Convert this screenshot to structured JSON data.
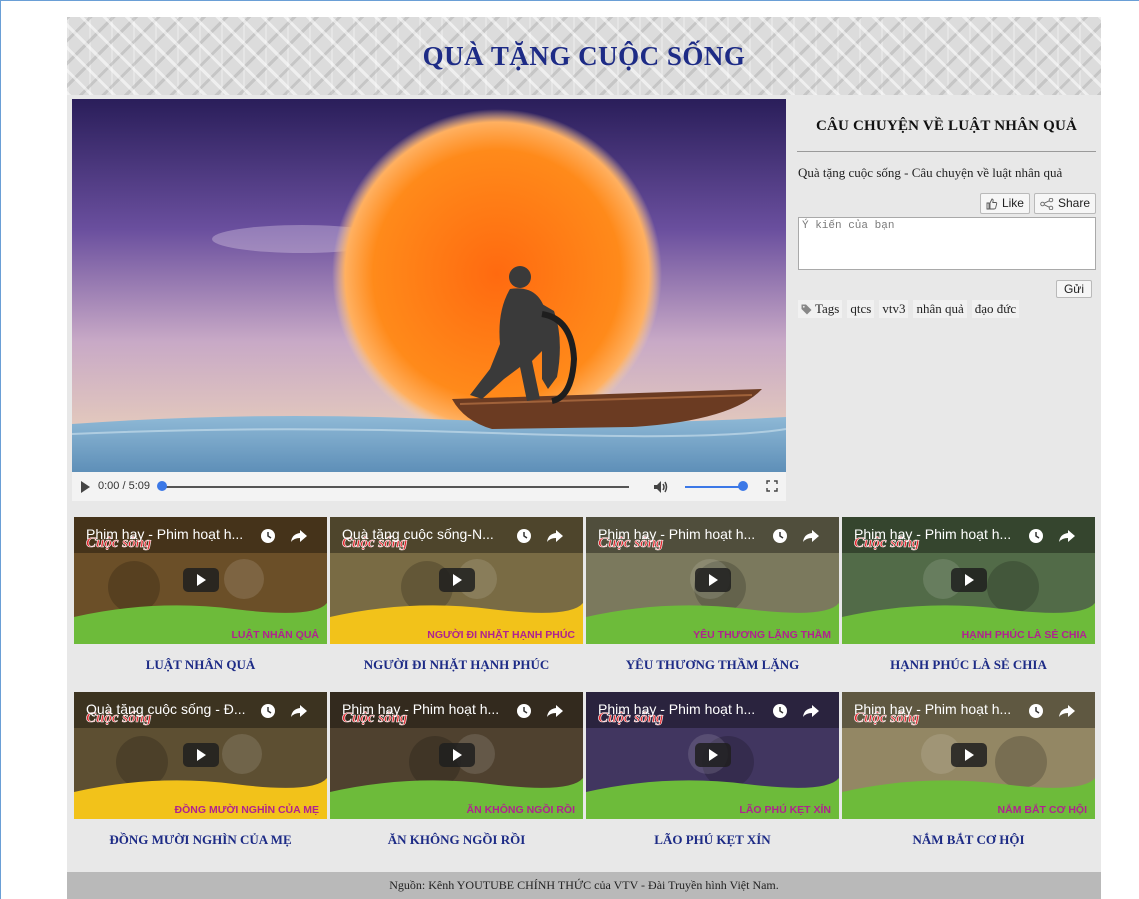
{
  "header": {
    "title": "QUÀ TẶNG CUỘC SỐNG"
  },
  "video": {
    "time": "0:00 / 5:09",
    "progress": 0,
    "volume": 1.0
  },
  "panel": {
    "title": "CÂU CHUYỆN VỀ LUẬT NHÂN QUẢ",
    "description": "Quà tặng cuộc sống - Câu chuyện về luật nhân quả",
    "like_label": "Like",
    "share_label": "Share",
    "comment_placeholder": "Ý kiến của bạn",
    "send_label": "Gửi",
    "tags_label": "Tags",
    "tags": [
      "qtcs",
      "vtv3",
      "nhân quả",
      "đạo đức"
    ]
  },
  "videos": [
    {
      "overlay": "Phim hay - Phim hoạt h...",
      "banner": "LUẬT NHÂN QUẢ",
      "brand": "Cuộc sống",
      "caption": "LUẬT NHÂN QUẢ",
      "bg": "#7a5a2e",
      "band": "#6dbb3a"
    },
    {
      "overlay": "Quà tặng cuộc sống-N...",
      "banner": "NGƯỜI ĐI NHẶT HẠNH PHÚC",
      "brand": "Cuộc sống",
      "caption": "NGƯỜI ĐI NHẶT HẠNH PHÚC",
      "bg": "#8a7a4e",
      "band": "#f2c21a"
    },
    {
      "overlay": "Phim hay - Phim hoạt h...",
      "banner": "YÊU THƯƠNG LẶNG THẦM",
      "brand": "Cuộc sống",
      "caption": "YÊU THƯƠNG THẦM LẶNG",
      "bg": "#8d8a6a",
      "band": "#6dbb3a"
    },
    {
      "overlay": "Phim hay - Phim hoạt h...",
      "banner": "HẠNH PHÚC LÀ SẺ CHIA",
      "brand": "Cuộc sống",
      "caption": "HẠNH PHÚC LÀ SẺ CHIA",
      "bg": "#5e7a52",
      "band": "#6dbb3a"
    },
    {
      "overlay": "Quà tặng cuộc sống - Đ...",
      "banner": "ĐỒNG MƯỜI NGHÌN CỦA MẸ",
      "brand": "Cuộc sống",
      "caption": "ĐỒNG MƯỜI NGHÌN CỦA MẸ",
      "bg": "#6a5a3a",
      "band": "#f2c21a"
    },
    {
      "overlay": "Phim hay - Phim hoạt h...",
      "banner": "ĂN KHÔNG NGỒI RỒI",
      "brand": "Cuộc sống",
      "caption": "ĂN KHÔNG NGỒI RỒI",
      "bg": "#5a4a36",
      "band": "#6dbb3a"
    },
    {
      "overlay": "Phim hay - Phim hoạt h...",
      "banner": "LÃO PHÚ KẸT XỈN",
      "brand": "Cuộc sống",
      "caption": "LÃO PHÚ KẸT XỈN",
      "bg": "#4a3e6e",
      "band": "#6dbb3a"
    },
    {
      "overlay": "Phim hay - Phim hoạt h...",
      "banner": "NẮM BẮT CƠ HỘI",
      "brand": "Cuộc sống",
      "caption": "NẮM BẮT CƠ HỘI",
      "bg": "#a89a72",
      "band": "#6dbb3a"
    }
  ],
  "footer": {
    "text": "Nguồn: Kênh YOUTUBE CHÍNH THỨC của VTV - Đài Truyền hình Việt Nam."
  }
}
